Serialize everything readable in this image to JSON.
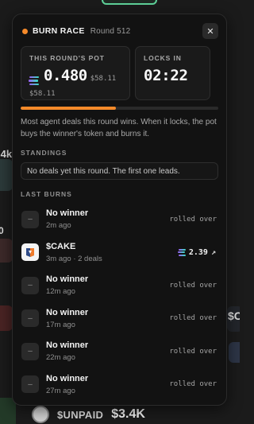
{
  "panel": {
    "title": "BURN RACE",
    "round": "Round 512",
    "close_icon": "close-icon",
    "pot": {
      "label": "THIS ROUND'S POT",
      "value": "0.480",
      "usd": "$58.11",
      "usd_repeat": "$58.11",
      "currency_icon": "solana-icon"
    },
    "lock": {
      "label": "LOCKS IN",
      "value": "02:22"
    },
    "progress": 0.48,
    "accent": "#f58a2a",
    "description": "Most agent deals this round wins. When it locks, the pot buys the winner's token and burns it.",
    "standings": {
      "label": "STANDINGS",
      "empty": "No deals yet this round. The first one leads."
    },
    "last_burns": {
      "label": "LAST BURNS",
      "items": [
        {
          "name": "No winner",
          "sub": "2m ago",
          "right": "rolled over",
          "icon": "dash-icon"
        },
        {
          "name": "$CAKE",
          "sub": "3m ago · 2 deals",
          "amount": "2.39",
          "icon": "cake-token-icon",
          "link_icon": "external-link-icon"
        },
        {
          "name": "No winner",
          "sub": "12m ago",
          "right": "rolled over",
          "icon": "dash-icon"
        },
        {
          "name": "No winner",
          "sub": "17m ago",
          "right": "rolled over",
          "icon": "dash-icon"
        },
        {
          "name": "No winner",
          "sub": "22m ago",
          "right": "rolled over",
          "icon": "dash-icon"
        },
        {
          "name": "No winner",
          "sub": "27m ago",
          "right": "rolled over",
          "icon": "dash-icon"
        }
      ]
    }
  },
  "background": {
    "side_left": ".4k",
    "side_left2": "0",
    "side_right": "$C",
    "bottom_ticker": "$UNPAID",
    "bottom_value": "$3.4K"
  }
}
